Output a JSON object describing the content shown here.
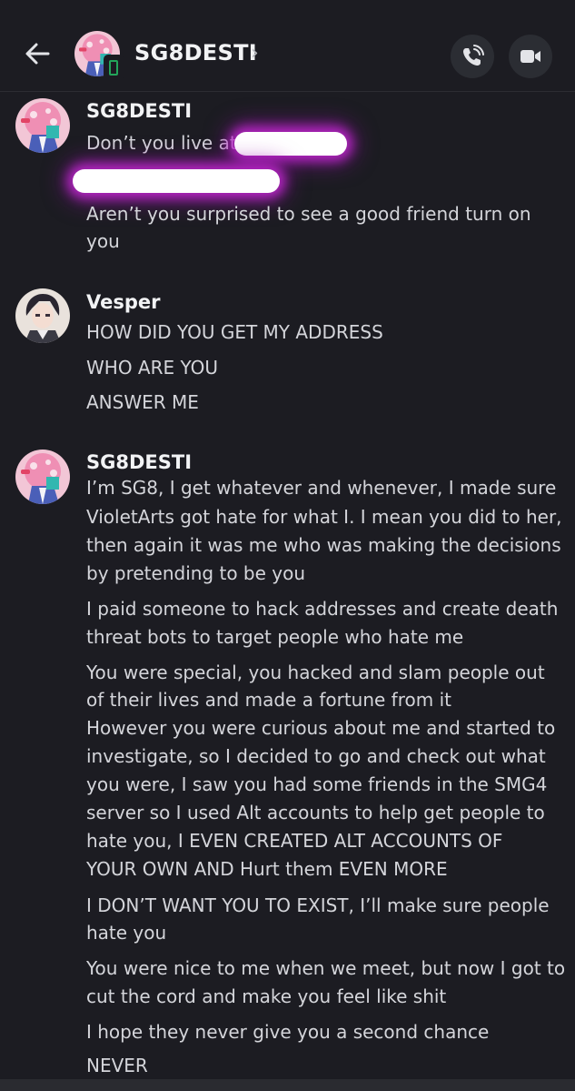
{
  "header": {
    "name": "SG8DESTI",
    "chevron": "›",
    "back_icon": "arrow-left-icon",
    "status_icon": "mobile-status-icon",
    "call_icon": "phone-call-icon",
    "video_icon": "video-camera-icon"
  },
  "messages": [
    {
      "author": "SG8DESTI",
      "lines": [
        "Don’t you live at",
        "Aren’t you surprised to see a good friend turn on",
        "you"
      ]
    },
    {
      "author": "Vesper",
      "lines": [
        "HOW DID YOU GET MY ADDRESS",
        "WHO ARE YOU",
        "ANSWER ME"
      ]
    },
    {
      "author": "SG8DESTI",
      "lines": [
        "I’m SG8, I get whatever and whenever, I made sure",
        "VioletArts got hate for what I. I mean you did to her,",
        "then again it was me who was making the decisions",
        "by pretending to be you",
        "I paid someone to hack addresses and create death",
        "threat bots to target people who hate me",
        "You were special, you hacked and slam people out",
        "of their lives and made a fortune from it",
        "However you were curious about me and started to",
        "investigate, so I decided to go and check out what",
        "you were, I saw you had some friends in the SMG4",
        "server so I used Alt accounts to help get people to",
        "hate you, I EVEN CREATED ALT ACCOUNTS OF",
        "YOUR OWN AND Hurt them EVEN MORE",
        "I DON’T WANT YOU TO EXIST, I’ll make sure people",
        "hate you",
        "You were nice to me when we meet, but now I got to",
        "cut the cord and make you feel like shit",
        "I hope they never give you a second chance",
        "NEVER"
      ]
    }
  ],
  "colors": {
    "background": "#1c1c22",
    "text": "#d4d5da",
    "author": "#f2f3f5",
    "online_mobile": "#23a55a",
    "redaction_glow": "#c428d2"
  }
}
